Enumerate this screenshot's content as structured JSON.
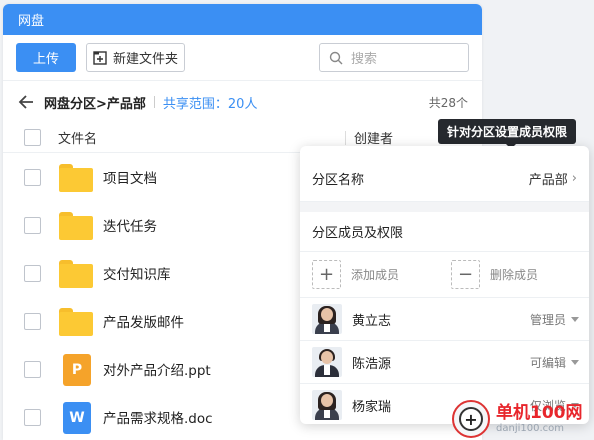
{
  "window": {
    "title": "网盘"
  },
  "toolbar": {
    "upload_label": "上传",
    "new_folder_label": "新建文件夹",
    "search_placeholder": "搜索"
  },
  "breadcrumb": {
    "path": "网盘分区>产品部",
    "share_scope": "共享范围：20人",
    "total": "共28个"
  },
  "table": {
    "headers": {
      "name": "文件名",
      "creator": "创建者"
    },
    "rows": [
      {
        "name": "项目文档",
        "type": "folder"
      },
      {
        "name": "迭代任务",
        "type": "folder"
      },
      {
        "name": "交付知识库",
        "type": "folder"
      },
      {
        "name": "产品发版邮件",
        "type": "folder"
      },
      {
        "name": "对外产品介绍.ppt",
        "type": "ppt",
        "badge": "P"
      },
      {
        "name": "产品需求规格.doc",
        "type": "word",
        "badge": "W"
      }
    ]
  },
  "tooltip": {
    "text": "针对分区设置成员权限"
  },
  "popup": {
    "zone_label": "分区名称",
    "zone_value": "产品部",
    "members_title": "分区成员及权限",
    "add_member": "添加成员",
    "remove_member": "删除成员",
    "members": [
      {
        "name": "黄立志",
        "role": "管理员",
        "avatar": "female"
      },
      {
        "name": "陈浩源",
        "role": "可编辑",
        "avatar": "male"
      },
      {
        "name": "杨家瑞",
        "role": "仅浏览",
        "avatar": "female"
      }
    ]
  },
  "watermark": {
    "name": "单机100网",
    "url": "danji100.com"
  },
  "colors": {
    "accent": "#3b8ff3",
    "folder": "#fcc934",
    "ppt": "#f5a32a",
    "tooltip_bg": "#26292e"
  }
}
